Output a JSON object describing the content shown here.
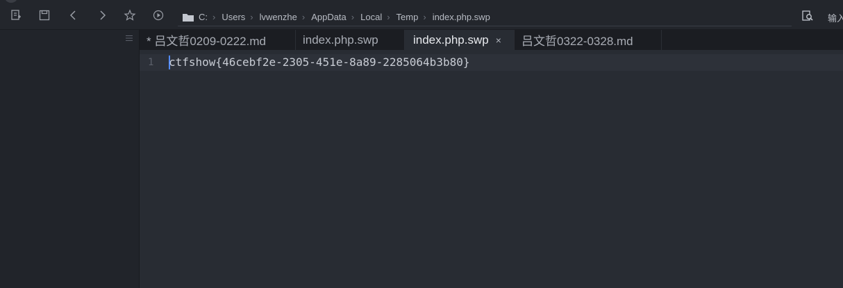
{
  "toolbar": {
    "buttons": [
      "new-file-icon",
      "save-icon",
      "back-icon",
      "forward-icon",
      "star-icon",
      "play-icon"
    ]
  },
  "breadcrumb": {
    "segments": [
      "C:",
      "Users",
      "lvwenzhe",
      "AppData",
      "Local",
      "Temp",
      "index.php.swp"
    ]
  },
  "right": {
    "label": "输入"
  },
  "tabs": [
    {
      "label": "* 吕文哲0209-0222.md",
      "active": false
    },
    {
      "label": "index.php.swp",
      "active": false
    },
    {
      "label": "index.php.swp",
      "active": true,
      "close": "×"
    },
    {
      "label": "吕文哲0322-0328.md",
      "active": false
    }
  ],
  "editor": {
    "line_number": "1",
    "content": "ctfshow{46cebf2e-2305-451e-8a89-2285064b3b80}"
  },
  "colors": {
    "background": "#282c33",
    "sidebar": "#21242a",
    "cursor": "#528bff",
    "text": "#c8ccd4"
  }
}
